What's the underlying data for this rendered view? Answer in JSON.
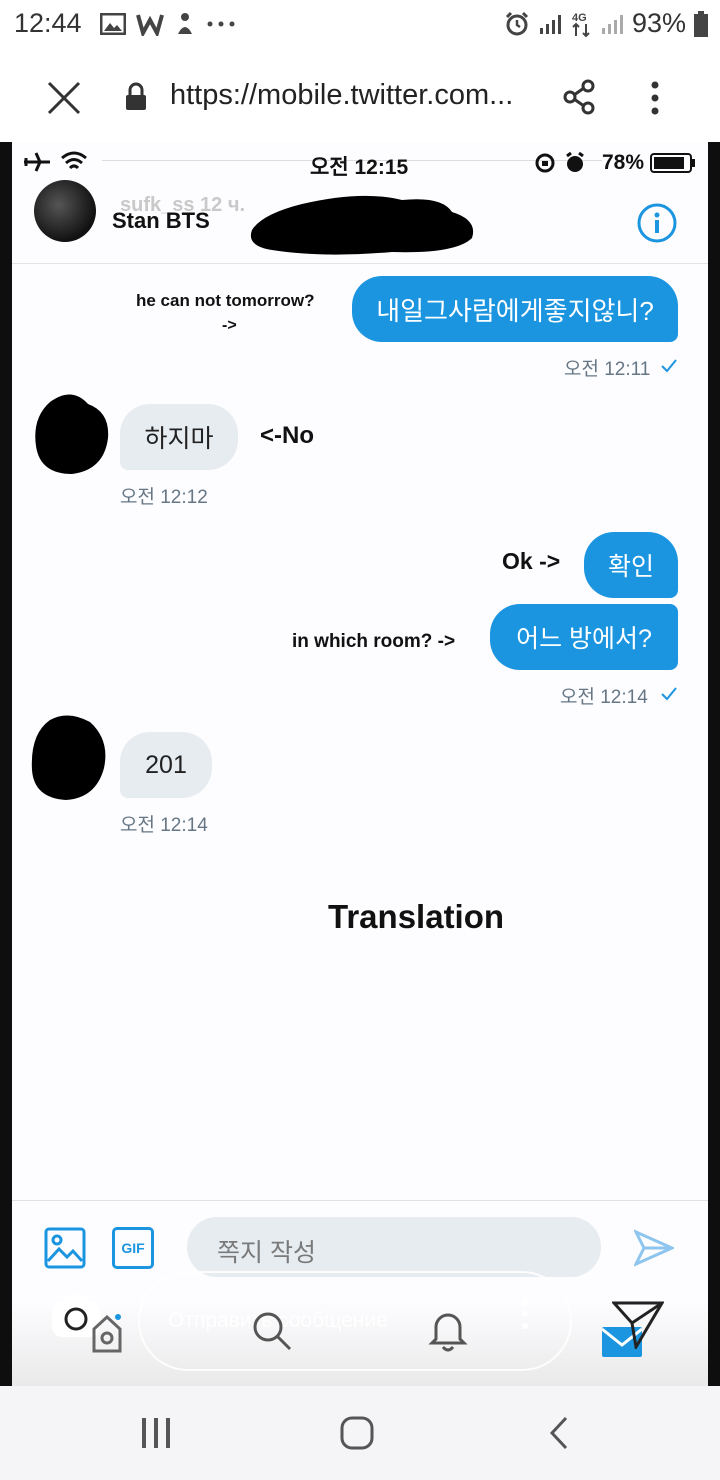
{
  "status_bar": {
    "time": "12:44",
    "network": "4G",
    "battery": "93%"
  },
  "browser": {
    "url": "https://mobile.twitter.com...",
    "icons": [
      "close-icon",
      "lock-icon",
      "share-icon",
      "more-vert-icon"
    ]
  },
  "ios_status": {
    "time": "오전 12:15",
    "battery": "78%"
  },
  "dm_header": {
    "ghost_text": "sufk_ss  12 ч.",
    "name": "Stan BTS",
    "info_icon": "info-icon"
  },
  "messages": [
    {
      "side": "me",
      "text": "내일그사람에게좋지않니?",
      "note": "he can not tomorrow?",
      "note2": "->",
      "time": "오전 12:11"
    },
    {
      "side": "them",
      "text": "하지마",
      "note": "<-No",
      "time": "오전 12:12"
    },
    {
      "side": "me",
      "text": "확인",
      "note": "Ok ->"
    },
    {
      "side": "me",
      "text": "어느 방에서?",
      "note": "in which room? ->",
      "time": "오전 12:14"
    },
    {
      "side": "them",
      "text": "201",
      "time": "오전 12:14"
    }
  ],
  "translation_label": "Translation",
  "compose": {
    "placeholder": "쪽지 작성",
    "gif_label": "GIF",
    "ig_placeholder": "Отправить сообщение"
  },
  "colors": {
    "accent": "#1b95e0",
    "bubble_them": "#e7ecf1"
  }
}
